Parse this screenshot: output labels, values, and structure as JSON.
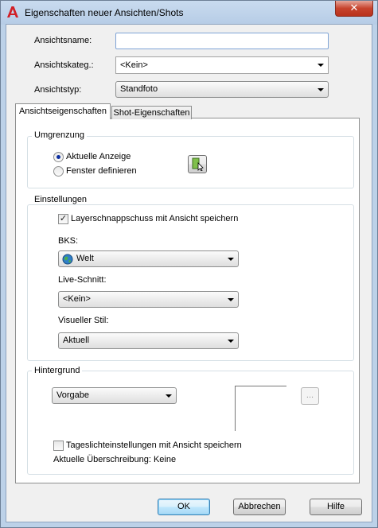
{
  "window": {
    "title": "Eigenschaften neuer Ansichten/Shots",
    "close_glyph": "✕",
    "app_icon": "autocad-a-icon"
  },
  "fields": {
    "view_name_label": "Ansichtsname:",
    "view_name_value": "",
    "category_label": "Ansichtskateg.:",
    "category_value": "<Kein>",
    "type_label": "Ansichtstyp:",
    "type_value": "Standfoto"
  },
  "tabs": {
    "active": "Ansichtseigenschaften",
    "inactive": "Shot-Eigenschaften"
  },
  "boundary": {
    "title": "Umgrenzung",
    "current_display": "Aktuelle Anzeige",
    "define_window": "Fenster definieren",
    "selected": "current_display",
    "pick_icon": "define-window-icon"
  },
  "settings": {
    "title": "Einstellungen",
    "save_layer_snapshot": "Layerschnappschuss mit Ansicht speichern",
    "save_layer_snapshot_checked": true,
    "ucs_label": "BKS:",
    "ucs_value": "Welt",
    "ucs_icon": "globe-icon",
    "live_section_label": "Live-Schnitt:",
    "live_section_value": "<Kein>",
    "visual_style_label": "Visueller Stil:",
    "visual_style_value": "Aktuell"
  },
  "background": {
    "title": "Hintergrund",
    "value": "Vorgabe",
    "browse_label": "...",
    "save_sun": "Tageslichteinstellungen mit Ansicht speichern",
    "save_sun_checked": false,
    "override": "Aktuelle Überschreibung: Keine"
  },
  "buttons": {
    "ok": "OK",
    "cancel": "Abbrechen",
    "help": "Hilfe"
  }
}
